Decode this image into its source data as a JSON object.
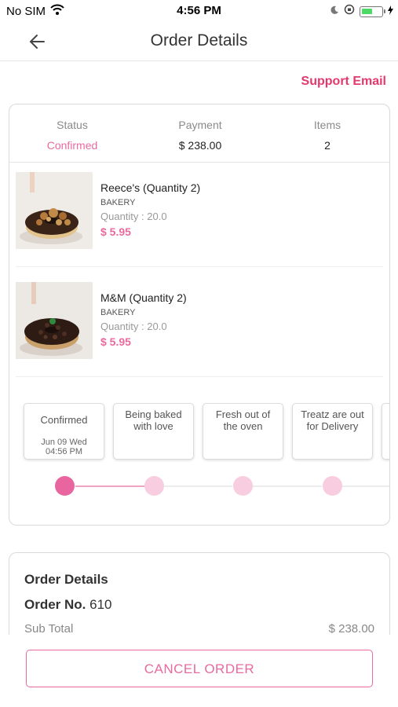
{
  "status_bar": {
    "carrier": "No SIM",
    "time": "4:56 PM",
    "battery_level": 0.55
  },
  "header": {
    "title": "Order Details"
  },
  "support_link": "Support Email",
  "summary": [
    {
      "label": "Status",
      "value": "Confirmed"
    },
    {
      "label": "Payment",
      "value": "$ 238.00"
    },
    {
      "label": "Items",
      "value": "2"
    }
  ],
  "products": [
    {
      "name": "Reece's (Quantity 2)",
      "category": "BAKERY",
      "quantity": "Quantity :  20.0",
      "price": "$ 5.95"
    },
    {
      "name": "M&M  (Quantity 2)",
      "category": "BAKERY",
      "quantity": "Quantity :  20.0",
      "price": "$ 5.95"
    }
  ],
  "steps": [
    {
      "title": "Confirmed",
      "date_line1": "Jun 09 Wed",
      "date_line2": "04:56 PM",
      "active": true
    },
    {
      "title_line1": "Being baked",
      "title_line2": "with love",
      "active": false
    },
    {
      "title_line1": "Fresh out of",
      "title_line2": "the oven",
      "active": false
    },
    {
      "title_line1": "Treatz are out",
      "title_line2": "for Delivery",
      "active": false
    }
  ],
  "order_details": {
    "title": "Order Details",
    "order_no_label": "Order No.",
    "order_no": "610",
    "subtotal_label": "Sub Total",
    "subtotal_value": "$ 238.00"
  },
  "cancel_button": "CANCEL ORDER",
  "colors": {
    "accent": "#e5386d",
    "pink": "#e96a9f",
    "pink_light": "#f8cde0",
    "active_dot": "#e8659f"
  }
}
